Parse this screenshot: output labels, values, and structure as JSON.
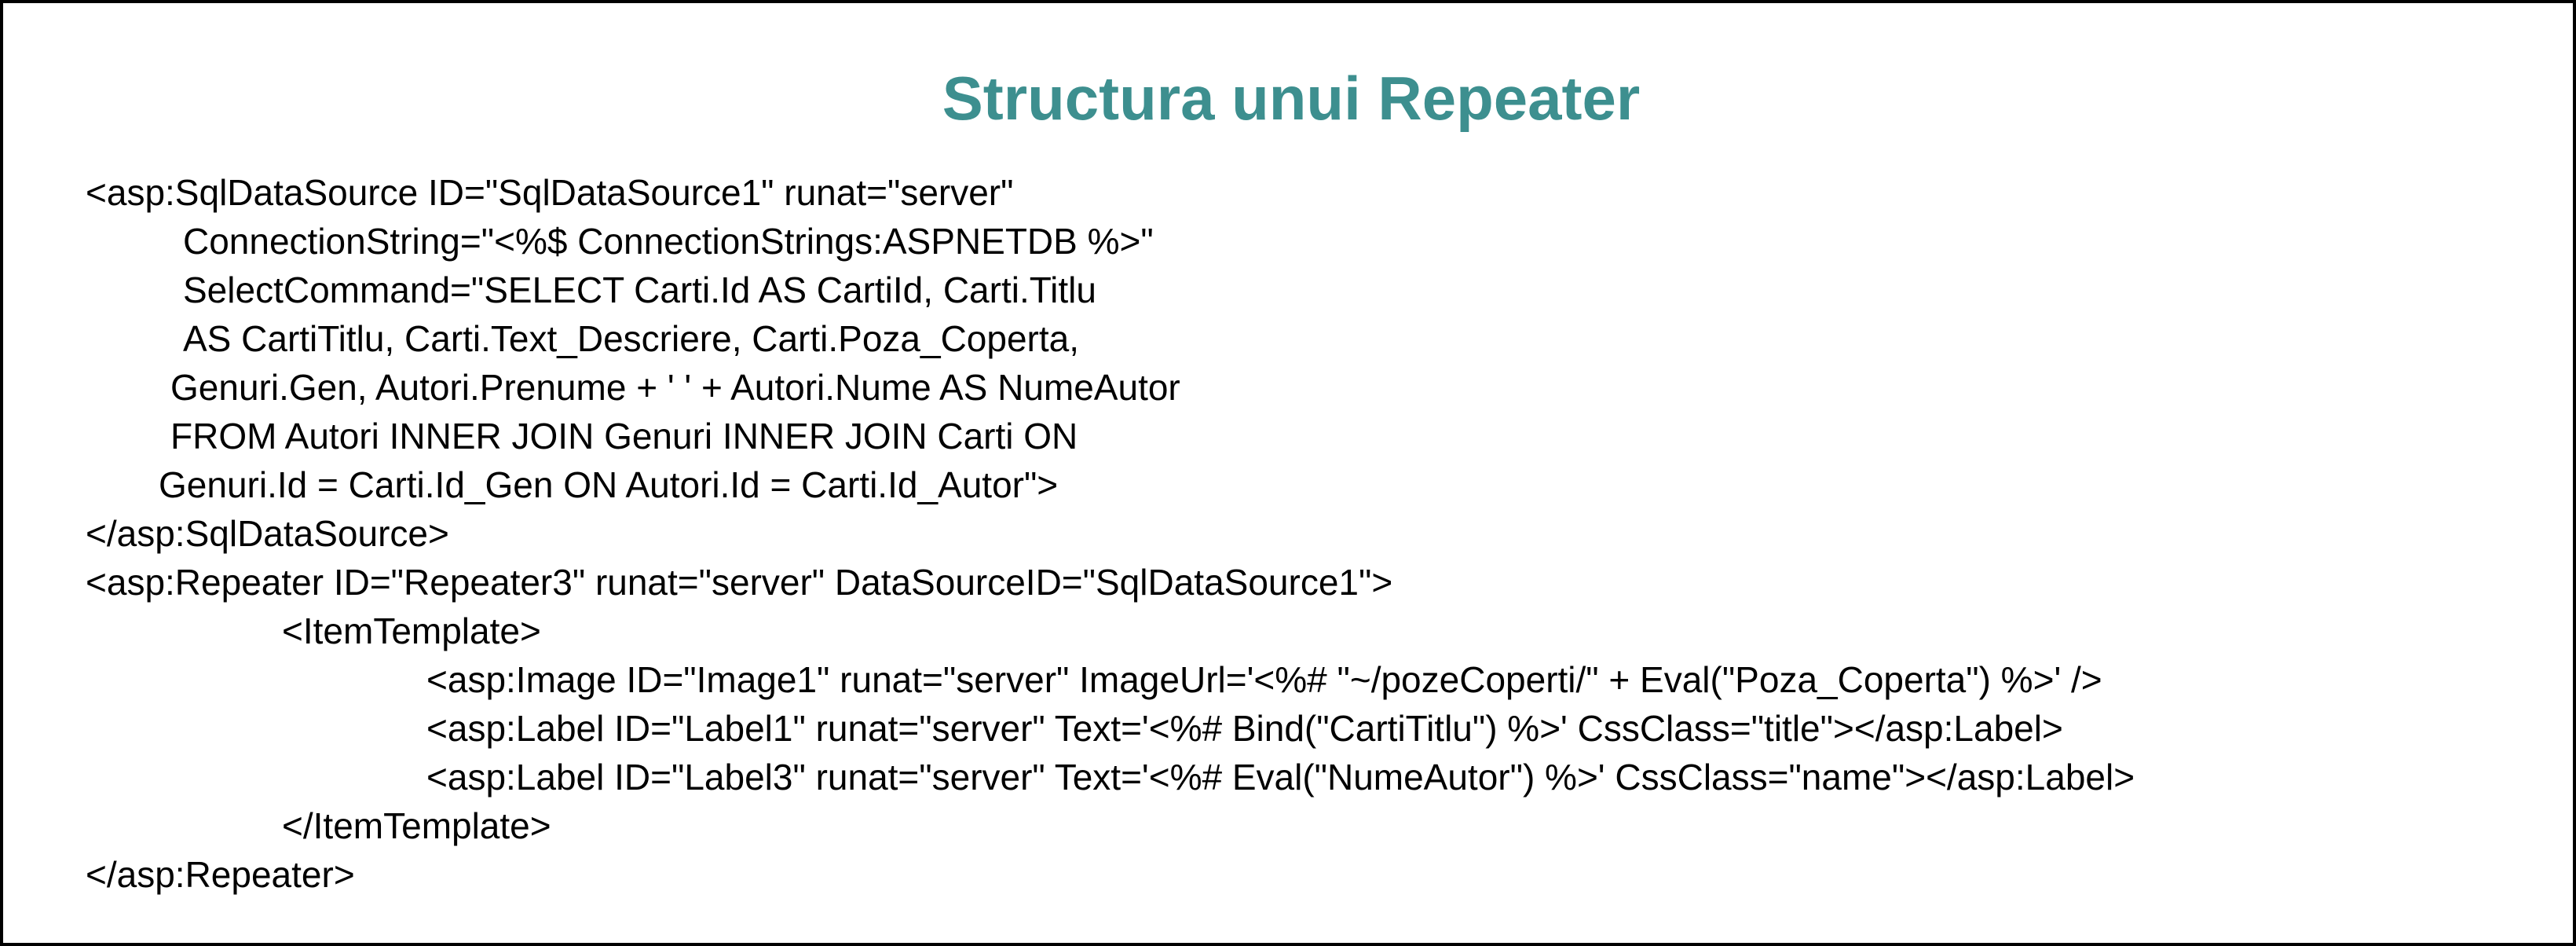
{
  "slide": {
    "title": "Structura unui Repeater",
    "title_color": "#3d8f8f",
    "code_lines": [
      "<asp:SqlDataSource ID=\"SqlDataSource1\" runat=\"server\"",
      "ConnectionString=\"<%$ ConnectionStrings:ASPNETDB %>\"",
      "SelectCommand=\"SELECT Carti.Id AS CartiId, Carti.Titlu",
      "AS CartiTitlu, Carti.Text_Descriere, Carti.Poza_Coperta,",
      "Genuri.Gen, Autori.Prenume + ' ' + Autori.Nume AS NumeAutor",
      "FROM Autori INNER JOIN Genuri INNER JOIN Carti ON",
      "Genuri.Id = Carti.Id_Gen ON Autori.Id = Carti.Id_Autor\">",
      "</asp:SqlDataSource>",
      "<asp:Repeater ID=\"Repeater3\" runat=\"server\" DataSourceID=\"SqlDataSource1\">",
      "<ItemTemplate>",
      "<asp:Image ID=\"Image1\" runat=\"server\" ImageUrl='<%# \"~/pozeCoperti/\" + Eval(\"Poza_Coperta\") %>' />",
      "<asp:Label ID=\"Label1\" runat=\"server\" Text='<%# Bind(\"CartiTitlu\") %>' CssClass=\"title\"></asp:Label>",
      "<asp:Label ID=\"Label3\" runat=\"server\" Text='<%# Eval(\"NumeAutor\") %>' CssClass=\"name\"></asp:Label>",
      "</ItemTemplate>",
      "</asp:Repeater>"
    ]
  }
}
